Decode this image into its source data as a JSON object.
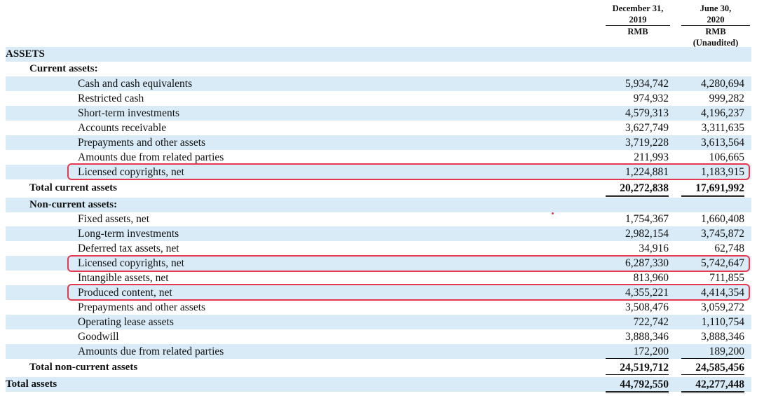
{
  "header": {
    "col1": {
      "line1": "December 31,",
      "line2": "2019",
      "line3": "RMB"
    },
    "col2": {
      "line1": "June 30,",
      "line2": "2020",
      "line3": "RMB",
      "line4": "(Unaudited)"
    }
  },
  "section_title": "ASSETS",
  "current_assets": {
    "heading": "Current assets:",
    "rows": [
      {
        "label": "Cash and cash equivalents",
        "v2019": "5,934,742",
        "v2020": "4,280,694"
      },
      {
        "label": "Restricted cash",
        "v2019": "974,932",
        "v2020": "999,282"
      },
      {
        "label": "Short-term investments",
        "v2019": "4,579,313",
        "v2020": "4,196,237"
      },
      {
        "label": "Accounts receivable",
        "v2019": "3,627,749",
        "v2020": "3,311,635"
      },
      {
        "label": "Prepayments and other assets",
        "v2019": "3,719,228",
        "v2020": "3,613,564"
      },
      {
        "label": "Amounts due from related parties",
        "v2019": "211,993",
        "v2020": "106,665"
      },
      {
        "label": "Licensed copyrights, net",
        "v2019": "1,224,881",
        "v2020": "1,183,915"
      }
    ],
    "total": {
      "label": "Total current assets",
      "v2019": "20,272,838",
      "v2020": "17,691,992"
    }
  },
  "non_current_assets": {
    "heading": "Non-current assets:",
    "rows": [
      {
        "label": "Fixed assets, net",
        "v2019": "1,754,367",
        "v2020": "1,660,408"
      },
      {
        "label": "Long-term investments",
        "v2019": "2,982,154",
        "v2020": "3,745,872"
      },
      {
        "label": "Deferred tax assets, net",
        "v2019": "34,916",
        "v2020": "62,748"
      },
      {
        "label": "Licensed copyrights, net",
        "v2019": "6,287,330",
        "v2020": "5,742,647"
      },
      {
        "label": "Intangible assets, net",
        "v2019": "813,960",
        "v2020": "711,855"
      },
      {
        "label": "Produced content, net",
        "v2019": "4,355,221",
        "v2020": "4,414,354"
      },
      {
        "label": "Prepayments and other assets",
        "v2019": "3,508,476",
        "v2020": "3,059,272"
      },
      {
        "label": "Operating lease assets",
        "v2019": "722,742",
        "v2020": "1,110,754"
      },
      {
        "label": "Goodwill",
        "v2019": "3,888,346",
        "v2020": "3,888,346"
      },
      {
        "label": "Amounts due from related parties",
        "v2019": "172,200",
        "v2020": "189,200"
      }
    ],
    "total": {
      "label": "Total non-current assets",
      "v2019": "24,519,712",
      "v2020": "24,585,456"
    }
  },
  "total_assets": {
    "label": "Total assets",
    "v2019": "44,792,550",
    "v2020": "42,277,448"
  },
  "colors": {
    "row_shade": "#d9ebf7",
    "highlight": "#e53850"
  }
}
